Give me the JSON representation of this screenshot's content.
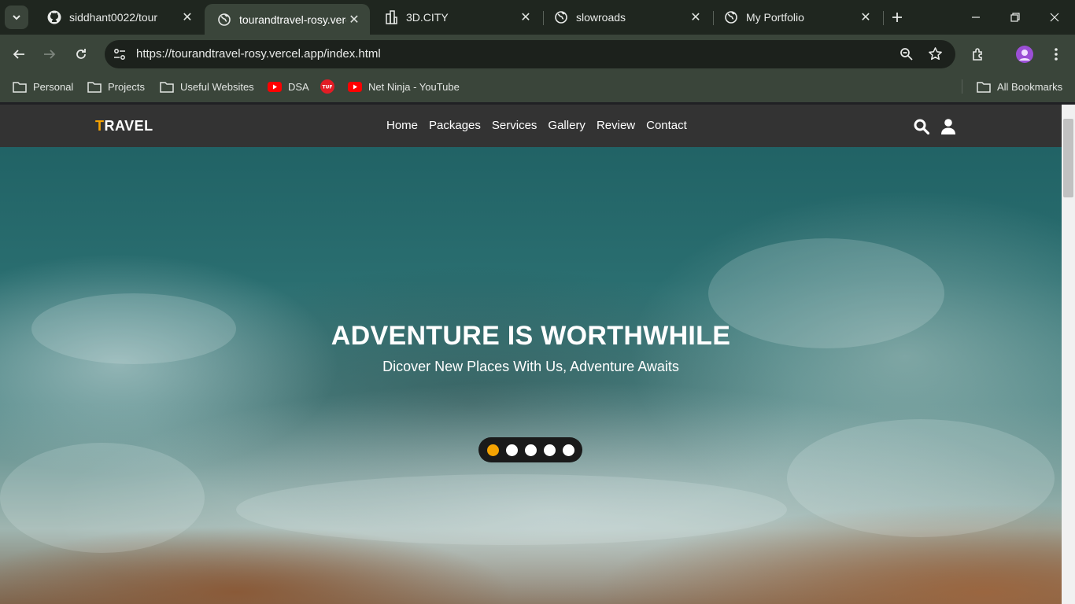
{
  "tabs": [
    {
      "title": "siddhant0022/tour",
      "icon": "github-icon"
    },
    {
      "title": "tourandtravel-rosy.vercel.app",
      "icon": "globe-icon",
      "active": true
    },
    {
      "title": "3D.CITY",
      "icon": "city-icon"
    },
    {
      "title": "slowroads",
      "icon": "globe-icon"
    },
    {
      "title": "My Portfolio",
      "icon": "globe-icon"
    }
  ],
  "address_bar": {
    "url": "https://tourandtravel-rosy.vercel.app/index.html"
  },
  "bookmarks": [
    {
      "label": "Personal",
      "icon": "folder-icon"
    },
    {
      "label": "Projects",
      "icon": "folder-icon"
    },
    {
      "label": "Useful Websites",
      "icon": "folder-icon"
    },
    {
      "label": "DSA",
      "icon": "youtube-icon"
    },
    {
      "label": "",
      "icon": "tuf-icon",
      "badge": "TUF"
    },
    {
      "label": "Net Ninja - YouTube",
      "icon": "youtube-icon"
    }
  ],
  "all_bookmarks": "All Bookmarks",
  "site": {
    "logo_first": "T",
    "logo_rest": "RAVEL",
    "menu": [
      "Home",
      "Packages",
      "Services",
      "Gallery",
      "Review",
      "Contact"
    ],
    "hero_title": "ADVENTURE IS WORTHWHILE",
    "hero_subtitle": "Dicover New Places With Us, Adventure Awaits",
    "slider_count": 5,
    "active_slide": 1
  },
  "colors": {
    "accent": "#f5a302",
    "navbar": "#333333",
    "chrome": "#3a453a"
  }
}
